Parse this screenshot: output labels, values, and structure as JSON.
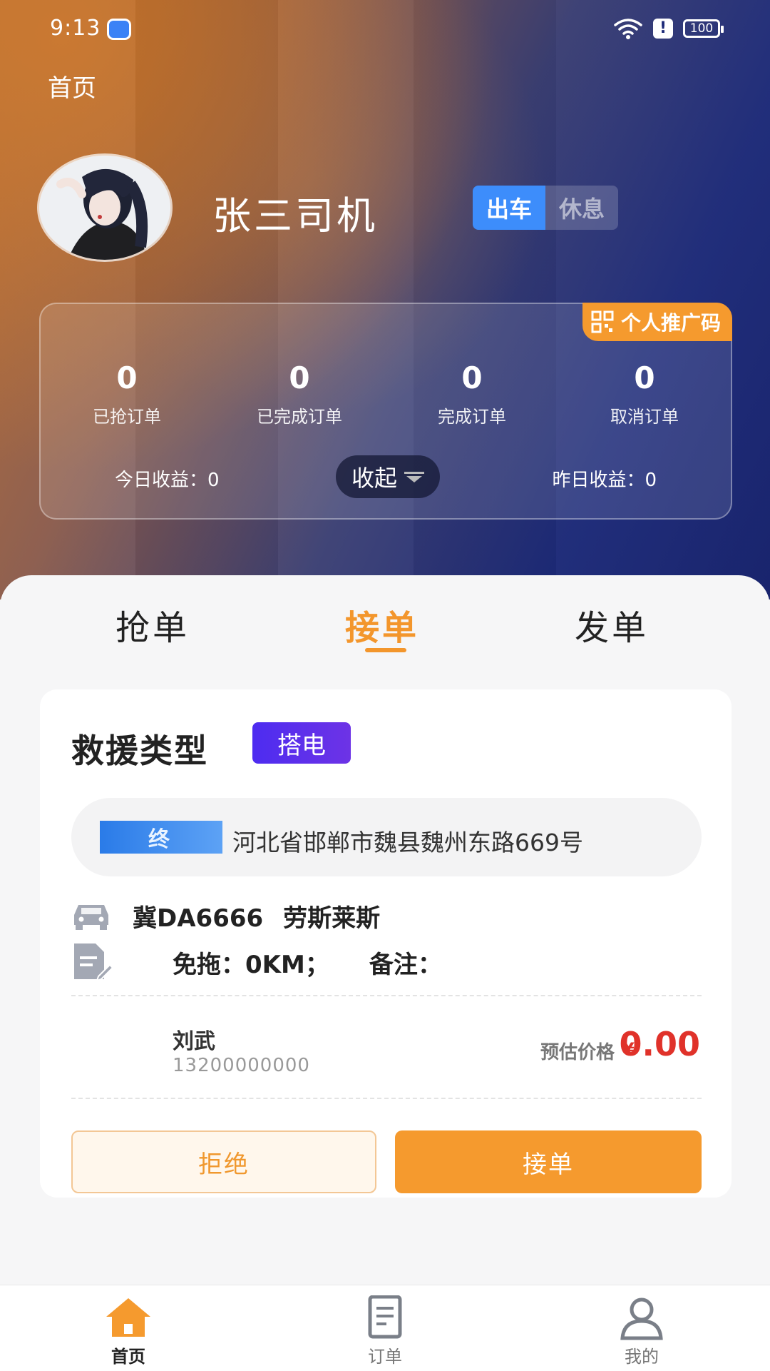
{
  "status_bar": {
    "time": "9:13",
    "battery": "100"
  },
  "header": {
    "home_label": "首页",
    "driver_name": "张三司机",
    "mode_on": "出车",
    "mode_off": "休息"
  },
  "stats": {
    "promo_label": "个人推广码",
    "items": [
      {
        "value": "0",
        "label": "已抢订单"
      },
      {
        "value": "0",
        "label": "已完成订单"
      },
      {
        "value": "0",
        "label": "完成订单"
      },
      {
        "value": "0",
        "label": "取消订单"
      }
    ],
    "today_earnings": "今日收益：0",
    "yesterday_earnings": "昨日收益：0",
    "collapse_label": "收起"
  },
  "tabs": [
    {
      "label": "抢单",
      "active": false
    },
    {
      "label": "接单",
      "active": true
    },
    {
      "label": "发单",
      "active": false
    }
  ],
  "order": {
    "rescue_type_label": "救援类型",
    "rescue_type_value": "搭电",
    "address_tag": "终",
    "address": "河北省邯郸市魏县魏州东路669号",
    "plate": "冀DA6666",
    "car_model": "劳斯莱斯",
    "tow": "免拖：0KM；",
    "remark": "备注：",
    "contact_name": "刘武",
    "contact_phone": "13200000000",
    "price_label": "预估价格",
    "price_currency": "¥",
    "price_value": "0.00",
    "reject_label": "拒绝",
    "accept_label": "接单"
  },
  "bottom_nav": [
    {
      "label": "首页",
      "icon": "home-icon",
      "active": true
    },
    {
      "label": "订单",
      "icon": "document-icon",
      "active": false
    },
    {
      "label": "我的",
      "icon": "user-icon",
      "active": false
    }
  ],
  "colors": {
    "accent": "#f3962c",
    "primary_blue": "#3d8dfb",
    "price_red": "#e0322a",
    "badge_purple": "#5a2eeb"
  }
}
